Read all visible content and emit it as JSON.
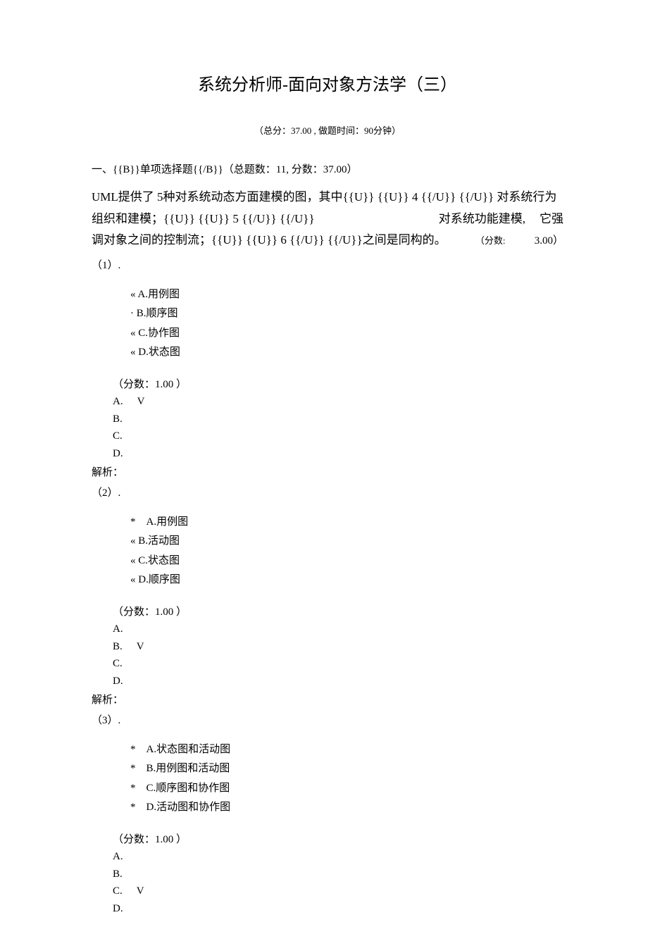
{
  "title": "系统分析师-面向对象方法学（三）",
  "subtitle": "（总分：37.00 , 做题时间：90分钟）",
  "sectionHeader": "一、{{B}}单项选择题{{/B}}（总题数：11, 分数：37.00）",
  "questionStem": {
    "line1_left": "UML提供了 5种对系统动态方面建模的图，其中{{U}} {{U}} 4 {{/U}} {{/U}} 对系统行为",
    "line2_left": "组织和建模；{{U}} {{U}} 5 {{/U}} {{/U}}",
    "line2_right": "对系统功能建模,",
    "line2_far": "它强",
    "line3_left": "调对象之间的控制流；{{U}} {{U}} 6 {{/U}} {{/U}}之间是同构的。",
    "line3_score_label": "（分数:",
    "line3_score_value": "3.00）"
  },
  "subQuestions": [
    {
      "num": "（1）.",
      "options": [
        {
          "bullet": "«",
          "text": "A.用例图"
        },
        {
          "bullet": "·",
          "text": "B.顺序图"
        },
        {
          "bullet": "«",
          "text": "C.协作图"
        },
        {
          "bullet": "«",
          "text": "D.状态图"
        }
      ],
      "score": "（分数：1.00 ）",
      "answers": [
        {
          "label": "A.",
          "correct": true
        },
        {
          "label": "B.",
          "correct": false
        },
        {
          "label": "C.",
          "correct": false
        },
        {
          "label": "D.",
          "correct": false
        }
      ],
      "analysis": "解析："
    },
    {
      "num": "（2）.",
      "options": [
        {
          "bullet": "*",
          "text": "A.用例图",
          "indent": true
        },
        {
          "bullet": "«",
          "text": "B.活动图"
        },
        {
          "bullet": "«",
          "text": "C.状态图"
        },
        {
          "bullet": "«",
          "text": "D.顺序图"
        }
      ],
      "score": "（分数：1.00 ）",
      "answers": [
        {
          "label": "A.",
          "correct": false
        },
        {
          "label": "B.",
          "correct": true
        },
        {
          "label": "C.",
          "correct": false
        },
        {
          "label": "D.",
          "correct": false
        }
      ],
      "analysis": "解析："
    },
    {
      "num": "（3）.",
      "options": [
        {
          "bullet": "*",
          "text": "A.状态图和活动图",
          "indent": true
        },
        {
          "bullet": "*",
          "text": "B.用例图和活动图",
          "indent": true
        },
        {
          "bullet": "*",
          "text": "C.顺序图和协作图",
          "indent": true
        },
        {
          "bullet": "*",
          "text": "D.活动图和协作图",
          "indent": true
        }
      ],
      "score": "（分数：1.00 ）",
      "answers": [
        {
          "label": "A.",
          "correct": false
        },
        {
          "label": "B.",
          "correct": false
        },
        {
          "label": "C.",
          "correct": true
        },
        {
          "label": "D.",
          "correct": false
        }
      ],
      "analysis": ""
    }
  ],
  "checkmark": "V"
}
